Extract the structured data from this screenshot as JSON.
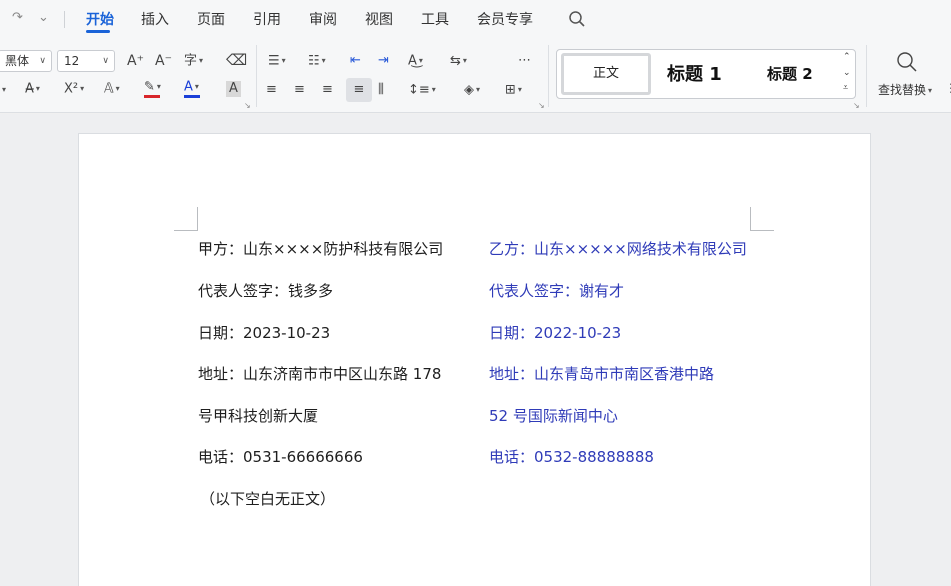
{
  "menu": {
    "tabs": [
      "开始",
      "插入",
      "页面",
      "引用",
      "审阅",
      "视图",
      "工具",
      "会员专享"
    ],
    "active_tab": "开始"
  },
  "ribbon": {
    "font_name": "黑体",
    "font_size": "12",
    "styles": {
      "normal": "正文",
      "heading1": "标题 1",
      "heading2": "标题 2"
    },
    "find_replace": "查找替换"
  },
  "document": {
    "party_a": {
      "name": "甲方：山东××××防护科技有限公司",
      "rep": "代表人签字：钱多多",
      "date": "日期：2023-10-23",
      "address1": "地址：山东济南市市中区山东路 178",
      "address2": "号甲科技创新大厦",
      "phone": "电话：0531-66666666"
    },
    "party_b": {
      "name": "乙方：山东×××××网络技术有限公司",
      "rep": "代表人签字：谢有才",
      "date": "日期：2022-10-23",
      "address1": "地址：山东青岛市市南区香港中路",
      "address2": "52 号国际新闻中心",
      "phone": "电话：0532-88888888"
    },
    "blank_note": "（以下空白无正文）"
  },
  "colors": {
    "accent": "#1a63d8",
    "party_b_text": "#2f3bb8",
    "font_color_bar": "#1a3fd8",
    "highlight_bar": "#d8262b"
  }
}
